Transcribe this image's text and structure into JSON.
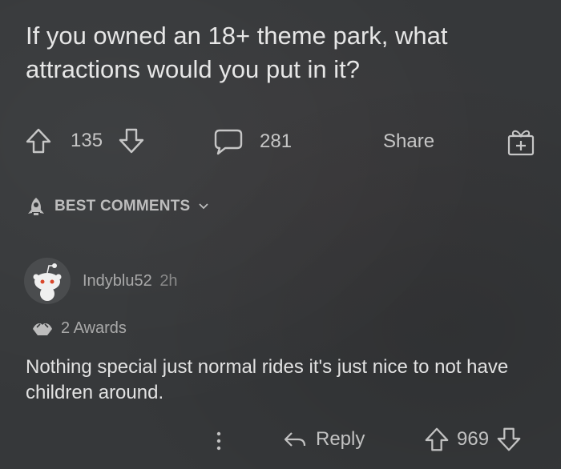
{
  "post": {
    "title": "If you owned an 18+ theme park, what attractions would you put in it?",
    "upvotes": "135",
    "comments": "281",
    "share_label": "Share"
  },
  "sort": {
    "label": "BEST COMMENTS"
  },
  "comment": {
    "username": "Indyblu52",
    "time": "2h",
    "awards": "2 Awards",
    "body": "Nothing special just normal rides it's just nice to not have children around.",
    "reply_label": "Reply",
    "votes": "969"
  }
}
